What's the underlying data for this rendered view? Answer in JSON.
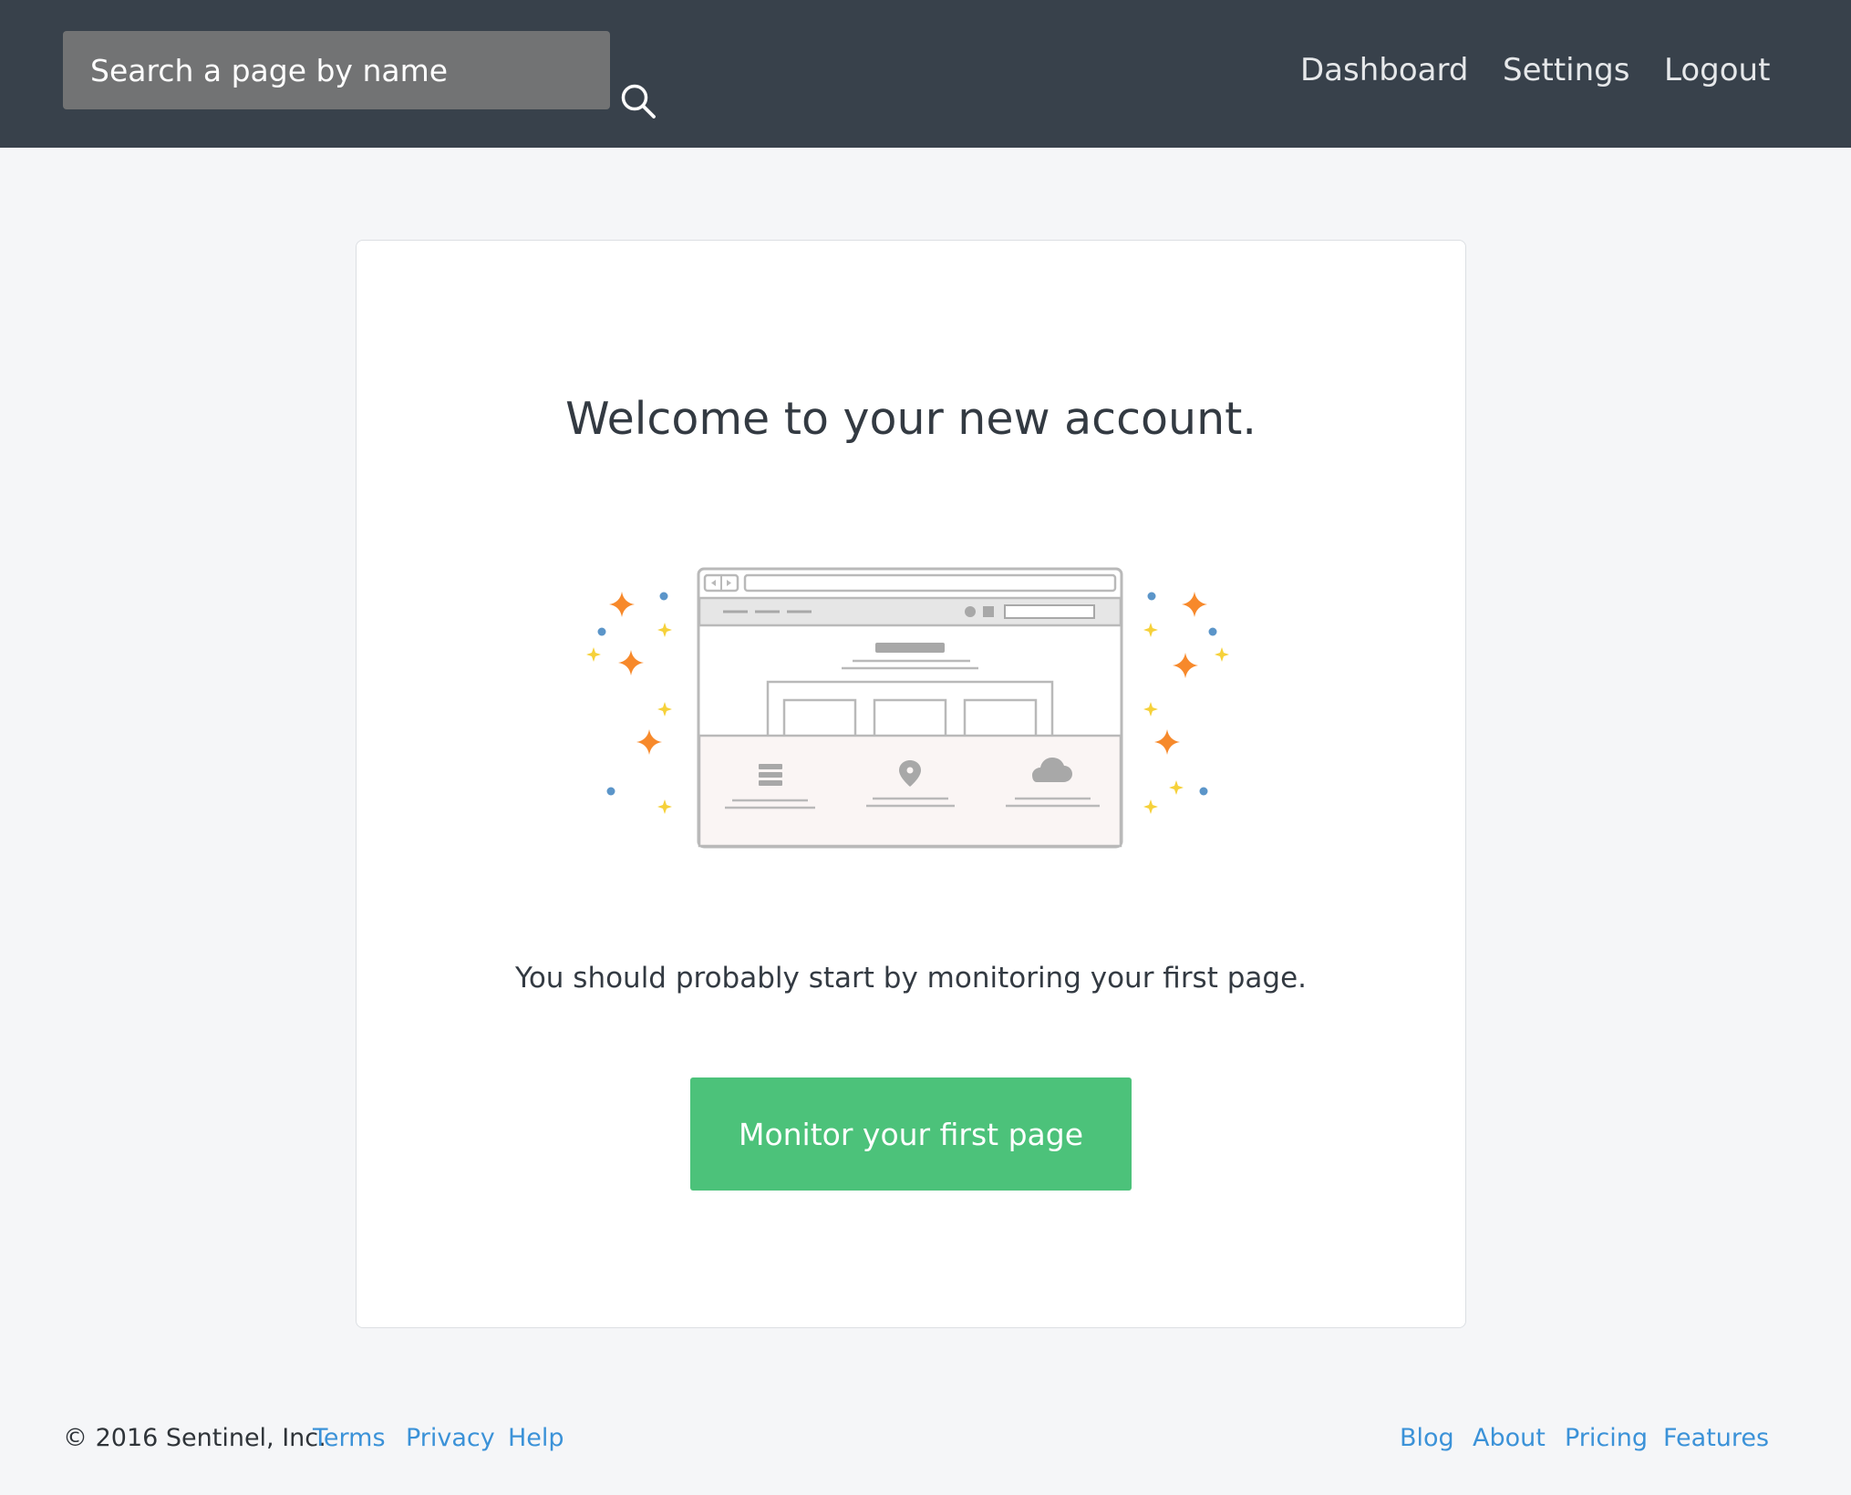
{
  "search": {
    "placeholder": "Search a page by name"
  },
  "nav": {
    "dashboard": "Dashboard",
    "settings": "Settings",
    "logout": "Logout"
  },
  "main": {
    "title": "Welcome to your new account.",
    "subtitle": "You should probably start by monitoring your first page.",
    "cta_label": "Monitor your first page"
  },
  "footer": {
    "copyright": "© 2016 Sentinel, Inc.",
    "left_links": [
      "Terms",
      "Privacy",
      "Help"
    ],
    "right_links": [
      "Blog",
      "About",
      "Pricing",
      "Features"
    ]
  },
  "colors": {
    "header_bg": "#38414b",
    "page_bg": "#f5f6f8",
    "cta_bg": "#4cc27a",
    "link": "#3b92d8",
    "sparkle_orange": "#f7892b",
    "sparkle_yellow": "#f6d13a",
    "dot_blue": "#5b95c9"
  }
}
